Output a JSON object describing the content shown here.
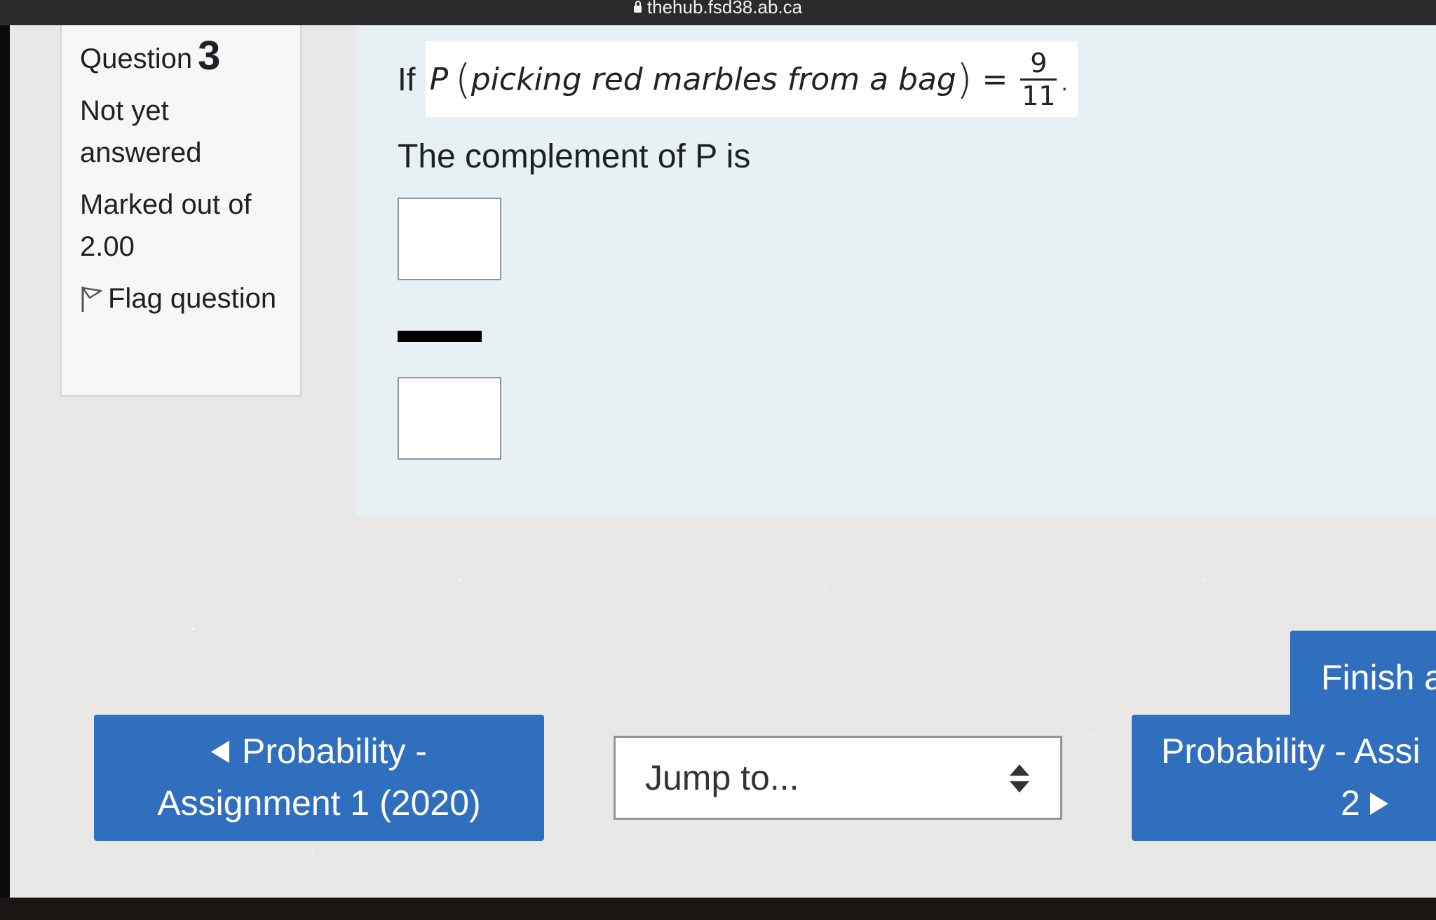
{
  "browser": {
    "url": "thehub.fsd38.ab.ca"
  },
  "info": {
    "question_label": "Question",
    "question_number": "3",
    "status": "Not yet answered",
    "marks": "Marked out of 2.00",
    "flag_label": "Flag question"
  },
  "question": {
    "if_word": "If",
    "expression_prefix": "P",
    "expression_event": "picking red marbles from a bag",
    "expression_equals": "=",
    "fraction_numerator": "9",
    "fraction_denominator": "11",
    "expression_suffix": ".",
    "prompt": "The complement of P is",
    "numerator_answer": "",
    "denominator_answer": ""
  },
  "navigation": {
    "previous_line1": "Probability -",
    "previous_line2": "Assignment 1 (2020)",
    "jump_to": "Jump to...",
    "next_line1": "Probability - Assi",
    "next_line2": "2",
    "finish_label": "Finish a"
  },
  "colors": {
    "button_blue": "#306ebe",
    "content_bg": "#e7f0f3",
    "page_bg": "#e9e8e7"
  },
  "icons": [
    "lock-icon",
    "flag-icon",
    "left-arrow-icon",
    "right-arrow-icon",
    "select-arrows-icon"
  ]
}
